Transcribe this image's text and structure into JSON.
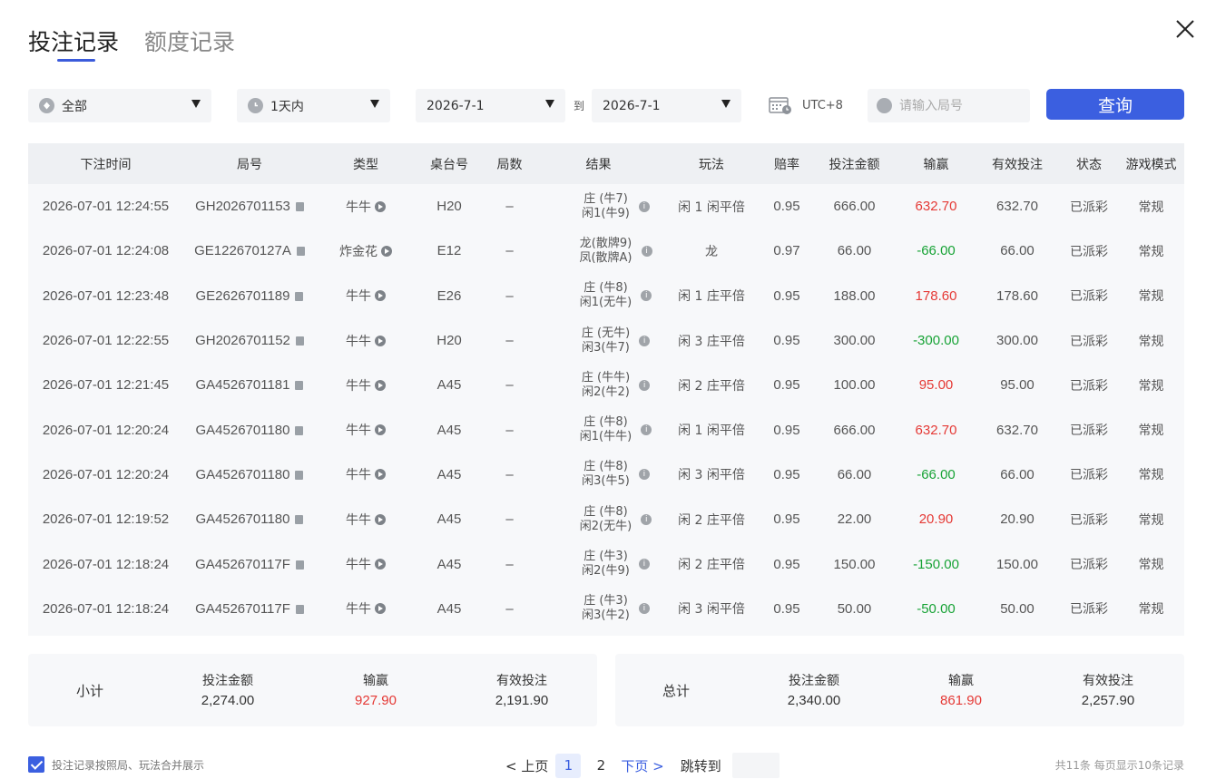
{
  "tabs": [
    {
      "label": "投注记录",
      "active": true
    },
    {
      "label": "额度记录",
      "active": false
    }
  ],
  "filters": {
    "game_select": "全部",
    "period_select": "1天内",
    "date_from": "2026-7-1",
    "to_label": "到",
    "date_to": "2026-7-1",
    "timezone": "UTC+8",
    "round_placeholder": "请输入局号",
    "query_label": "查询"
  },
  "table": {
    "headers": [
      "下注时间",
      "局号",
      "类型",
      "桌台号",
      "局数",
      "结果",
      "玩法",
      "赔率",
      "投注金额",
      "输赢",
      "有效投注",
      "状态",
      "游戏模式"
    ],
    "rows": [
      {
        "time": "2026-07-01 12:24:55",
        "round": "GH2026701153",
        "type": "牛牛",
        "table": "H20",
        "count": "–",
        "result1": "庄 (牛7)",
        "result2": "闲1(牛9)",
        "play": "闲 1 闲平倍",
        "odds": "0.95",
        "amount": "666.00",
        "win": "632.70",
        "win_sign": "pos",
        "valid": "632.70",
        "status": "已派彩",
        "mode": "常规"
      },
      {
        "time": "2026-07-01 12:24:08",
        "round": "GE122670127A",
        "type": "炸金花",
        "table": "E12",
        "count": "–",
        "result1": "龙(散牌9)",
        "result2": "凤(散牌A)",
        "play": "龙",
        "odds": "0.97",
        "amount": "66.00",
        "win": "-66.00",
        "win_sign": "neg",
        "valid": "66.00",
        "status": "已派彩",
        "mode": "常规"
      },
      {
        "time": "2026-07-01 12:23:48",
        "round": "GE2626701189",
        "type": "牛牛",
        "table": "E26",
        "count": "–",
        "result1": "庄 (牛8)",
        "result2": "闲1(无牛)",
        "play": "闲 1 庄平倍",
        "odds": "0.95",
        "amount": "188.00",
        "win": "178.60",
        "win_sign": "pos",
        "valid": "178.60",
        "status": "已派彩",
        "mode": "常规"
      },
      {
        "time": "2026-07-01 12:22:55",
        "round": "GH2026701152",
        "type": "牛牛",
        "table": "H20",
        "count": "–",
        "result1": "庄 (无牛)",
        "result2": "闲3(牛7)",
        "play": "闲 3 庄平倍",
        "odds": "0.95",
        "amount": "300.00",
        "win": "-300.00",
        "win_sign": "neg",
        "valid": "300.00",
        "status": "已派彩",
        "mode": "常规"
      },
      {
        "time": "2026-07-01 12:21:45",
        "round": "GA4526701181",
        "type": "牛牛",
        "table": "A45",
        "count": "–",
        "result1": "庄 (牛牛)",
        "result2": "闲2(牛2)",
        "play": "闲 2 庄平倍",
        "odds": "0.95",
        "amount": "100.00",
        "win": "95.00",
        "win_sign": "pos",
        "valid": "95.00",
        "status": "已派彩",
        "mode": "常规"
      },
      {
        "time": "2026-07-01 12:20:24",
        "round": "GA4526701180",
        "type": "牛牛",
        "table": "A45",
        "count": "–",
        "result1": "庄 (牛8)",
        "result2": "闲1(牛牛)",
        "play": "闲 1 闲平倍",
        "odds": "0.95",
        "amount": "666.00",
        "win": "632.70",
        "win_sign": "pos",
        "valid": "632.70",
        "status": "已派彩",
        "mode": "常规"
      },
      {
        "time": "2026-07-01 12:20:24",
        "round": "GA4526701180",
        "type": "牛牛",
        "table": "A45",
        "count": "–",
        "result1": "庄 (牛8)",
        "result2": "闲3(牛5)",
        "play": "闲 3 闲平倍",
        "odds": "0.95",
        "amount": "66.00",
        "win": "-66.00",
        "win_sign": "neg",
        "valid": "66.00",
        "status": "已派彩",
        "mode": "常规"
      },
      {
        "time": "2026-07-01 12:19:52",
        "round": "GA4526701180",
        "type": "牛牛",
        "table": "A45",
        "count": "–",
        "result1": "庄 (牛8)",
        "result2": "闲2(无牛)",
        "play": "闲 2 庄平倍",
        "odds": "0.95",
        "amount": "22.00",
        "win": "20.90",
        "win_sign": "pos",
        "valid": "20.90",
        "status": "已派彩",
        "mode": "常规"
      },
      {
        "time": "2026-07-01 12:18:24",
        "round": "GA452670117F",
        "type": "牛牛",
        "table": "A45",
        "count": "–",
        "result1": "庄 (牛3)",
        "result2": "闲2(牛9)",
        "play": "闲 2 庄平倍",
        "odds": "0.95",
        "amount": "150.00",
        "win": "-150.00",
        "win_sign": "neg",
        "valid": "150.00",
        "status": "已派彩",
        "mode": "常规"
      },
      {
        "time": "2026-07-01 12:18:24",
        "round": "GA452670117F",
        "type": "牛牛",
        "table": "A45",
        "count": "–",
        "result1": "庄 (牛3)",
        "result2": "闲3(牛2)",
        "play": "闲 3 闲平倍",
        "odds": "0.95",
        "amount": "50.00",
        "win": "-50.00",
        "win_sign": "neg",
        "valid": "50.00",
        "status": "已派彩",
        "mode": "常规"
      }
    ]
  },
  "subtotal": {
    "label": "小计",
    "amount_label": "投注金额",
    "amount": "2,274.00",
    "win_label": "输赢",
    "win": "927.90",
    "valid_label": "有效投注",
    "valid": "2,191.90"
  },
  "total": {
    "label": "总计",
    "amount_label": "投注金额",
    "amount": "2,340.00",
    "win_label": "输赢",
    "win": "861.90",
    "valid_label": "有效投注",
    "valid": "2,257.90"
  },
  "footer": {
    "merge_label": "投注记录按照局、玩法合并展示",
    "prev_label": "< 上页",
    "pages": [
      "1",
      "2"
    ],
    "current_page": "1",
    "next_label": "下页 >",
    "jump_label": "跳转到",
    "summary_note": "共11条  每页显示10条记录"
  },
  "colors": {
    "accent": "#3b5fe0",
    "win": "#e53935",
    "loss": "#18a336"
  },
  "icons": {
    "close": "close-icon",
    "game": "game-icon",
    "clock": "clock-icon",
    "calendar": "calendar-icon",
    "search": "search-icon",
    "copy": "copy-icon",
    "play": "play-icon",
    "info": "info-icon"
  }
}
